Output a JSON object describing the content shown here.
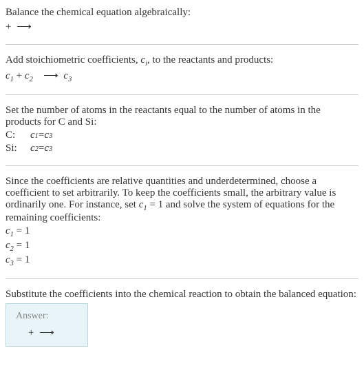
{
  "intro": {
    "line1": "Balance the chemical equation algebraically:",
    "eq_plus": " + ",
    "eq_arrow": "⟶"
  },
  "stoich": {
    "line1": "Add stoichiometric coefficients, ",
    "ci": "c",
    "ci_sub": "i",
    "line1_end": ", to the reactants and products:",
    "c1": "c",
    "c1_sub": "1",
    "plus": " + ",
    "c2": "c",
    "c2_sub": "2",
    "arrow": "⟶",
    "c3": "c",
    "c3_sub": "3"
  },
  "atoms": {
    "line1": "Set the number of atoms in the reactants equal to the number of atoms in the products for C and Si:",
    "rows": [
      {
        "label": "C:",
        "lhs_c": "c",
        "lhs_sub": "1",
        "eq": " = ",
        "rhs_c": "c",
        "rhs_sub": "3"
      },
      {
        "label": "Si:",
        "lhs_c": "c",
        "lhs_sub": "2",
        "eq": " = ",
        "rhs_c": "c",
        "rhs_sub": "3"
      }
    ]
  },
  "solve": {
    "line1_a": "Since the coefficients are relative quantities and underdetermined, choose a coefficient to set arbitrarily. To keep the coefficients small, the arbitrary value is ordinarily one. For instance, set ",
    "c1": "c",
    "c1_sub": "1",
    "line1_b": " = 1 and solve the system of equations for the remaining coefficients:",
    "eqs": [
      {
        "c": "c",
        "sub": "1",
        "rest": " = 1"
      },
      {
        "c": "c",
        "sub": "2",
        "rest": " = 1"
      },
      {
        "c": "c",
        "sub": "3",
        "rest": " = 1"
      }
    ]
  },
  "subst": {
    "line1": "Substitute the coefficients into the chemical reaction to obtain the balanced equation:"
  },
  "answer": {
    "label": "Answer:",
    "plus": " + ",
    "arrow": "⟶"
  }
}
